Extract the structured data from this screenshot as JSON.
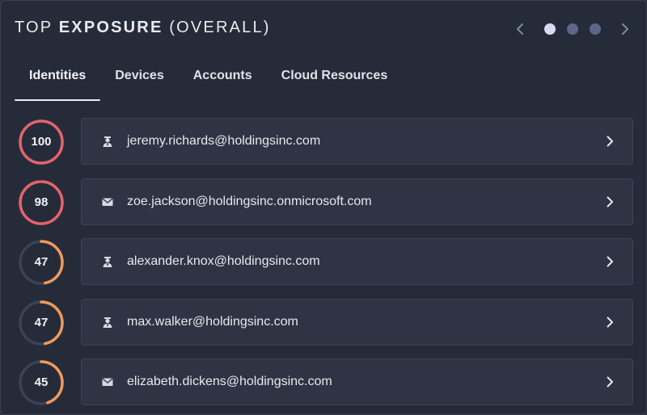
{
  "header": {
    "title_light_1": "TOP ",
    "title_bold": "EXPOSURE",
    "title_light_2": " (OVERALL)"
  },
  "pager": {
    "pages": 3,
    "active_page": 1,
    "prev_icon": "chevron-left-icon",
    "next_icon": "chevron-right-icon"
  },
  "tabs": [
    {
      "label": "Identities",
      "active": true
    },
    {
      "label": "Devices",
      "active": false
    },
    {
      "label": "Accounts",
      "active": false
    },
    {
      "label": "Cloud Resources",
      "active": false
    }
  ],
  "colors": {
    "high_risk": "#e5636b",
    "medium_risk": "#ef9a5a",
    "track": "#3b4253",
    "dot_active": "#d6dcf2",
    "dot_inactive": "#5c6788"
  },
  "rows": [
    {
      "score": "100",
      "score_fraction": 1.0,
      "level": "high",
      "icon": "user-icon",
      "email": "jeremy.richards@holdingsinc.com"
    },
    {
      "score": "98",
      "score_fraction": 0.98,
      "level": "high",
      "icon": "mail-icon",
      "email": "zoe.jackson@holdingsinc.onmicrosoft.com"
    },
    {
      "score": "47",
      "score_fraction": 0.47,
      "level": "medium",
      "icon": "user-icon",
      "email": "alexander.knox@holdingsinc.com"
    },
    {
      "score": "47",
      "score_fraction": 0.47,
      "level": "medium",
      "icon": "user-icon",
      "email": "max.walker@holdingsinc.com"
    },
    {
      "score": "45",
      "score_fraction": 0.45,
      "level": "medium",
      "icon": "mail-icon",
      "email": "elizabeth.dickens@holdingsinc.com"
    }
  ]
}
